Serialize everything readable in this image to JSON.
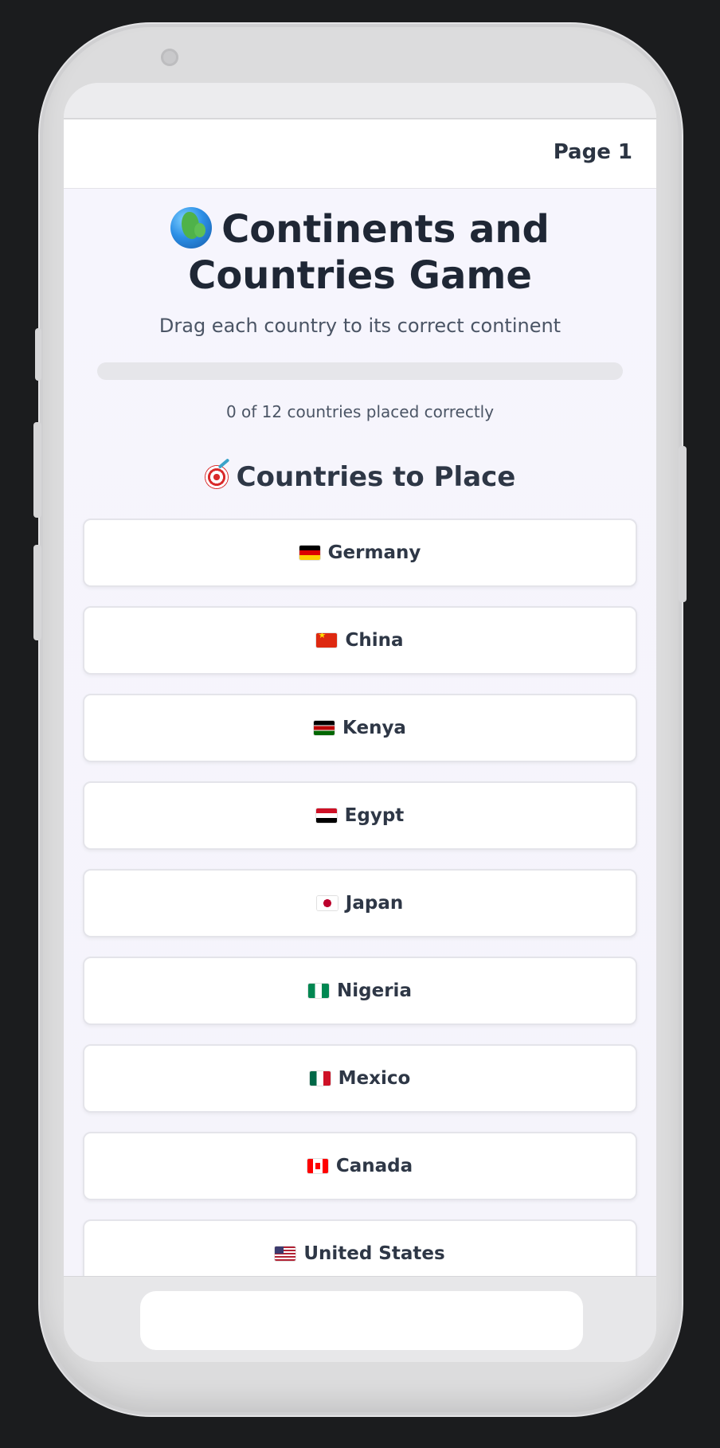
{
  "header": {
    "page_label": "Page 1"
  },
  "game": {
    "title": "Continents and Countries Game",
    "title_icon": "globe-icon",
    "subtitle": "Drag each country to its correct continent",
    "progress": {
      "placed": 0,
      "total": 12,
      "fraction": 0,
      "text": "0 of 12 countries placed correctly",
      "accent_color": "#6b5cf0"
    },
    "section_title": "Countries to Place",
    "section_icon": "target-icon",
    "countries": [
      {
        "name": "Germany",
        "flag": "flag-de"
      },
      {
        "name": "China",
        "flag": "flag-cn"
      },
      {
        "name": "Kenya",
        "flag": "flag-ke"
      },
      {
        "name": "Egypt",
        "flag": "flag-eg"
      },
      {
        "name": "Japan",
        "flag": "flag-jp"
      },
      {
        "name": "Nigeria",
        "flag": "flag-ng"
      },
      {
        "name": "Mexico",
        "flag": "flag-mx"
      },
      {
        "name": "Canada",
        "flag": "flag-ca"
      },
      {
        "name": "United States",
        "flag": "flag-us"
      }
    ]
  },
  "colors": {
    "background": "#1b1c1e",
    "text_dark": "#1f2735",
    "text_muted": "#4b5565",
    "card_border": "#e4e4ea"
  }
}
